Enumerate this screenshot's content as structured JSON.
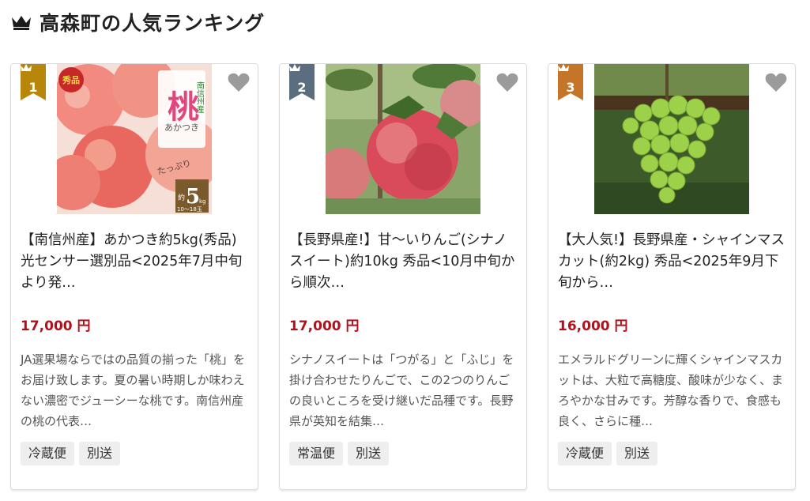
{
  "section": {
    "title": "高森町の人気ランキング"
  },
  "colors": {
    "gold": "#b8860b",
    "silver": "#5b6e80",
    "bronze": "#c4752a",
    "price": "#b3101c"
  },
  "cards": [
    {
      "rank": "1",
      "image_label": {
        "main": "桃",
        "region": "南信州産",
        "variety": "あかつき",
        "grade": "秀品",
        "amount_prefix": "約",
        "amount": "5",
        "amount_unit": "kg",
        "extra": "たっぷり",
        "count": "10〜18玉"
      },
      "title": "【南信州産】あかつき約5kg(秀品) 光センサー選別品<2025年7月中旬より発…",
      "price": "17,000 円",
      "description": "JA選果場ならではの品質の揃った「桃」をお届け致します。夏の暑い時期しか味わえない濃密でジューシーな桃です。南信州産の桃の代表…",
      "tags": [
        "冷蔵便",
        "別送"
      ]
    },
    {
      "rank": "2",
      "title": "【長野県産!】甘〜いりんご(シナノスイート)約10kg 秀品<10月中旬から順次…",
      "price": "17,000 円",
      "description": "シナノスイートは「つがる」と「ふじ」を掛け合わせたりんごで、この2つのりんごの良いところを受け継いだ品種です。長野県が英知を結集…",
      "tags": [
        "常温便",
        "別送"
      ]
    },
    {
      "rank": "3",
      "title": "【大人気!】長野県産・シャインマスカット(約2kg) 秀品<2025年9月下旬から…",
      "price": "16,000 円",
      "description": "エメラルドグリーンに輝くシャインマスカットは、大粒で高糖度、酸味が少なく、まろやかな甘みです。芳醇な香りで、食感も良く、さらに種…",
      "tags": [
        "冷蔵便",
        "別送"
      ]
    }
  ]
}
